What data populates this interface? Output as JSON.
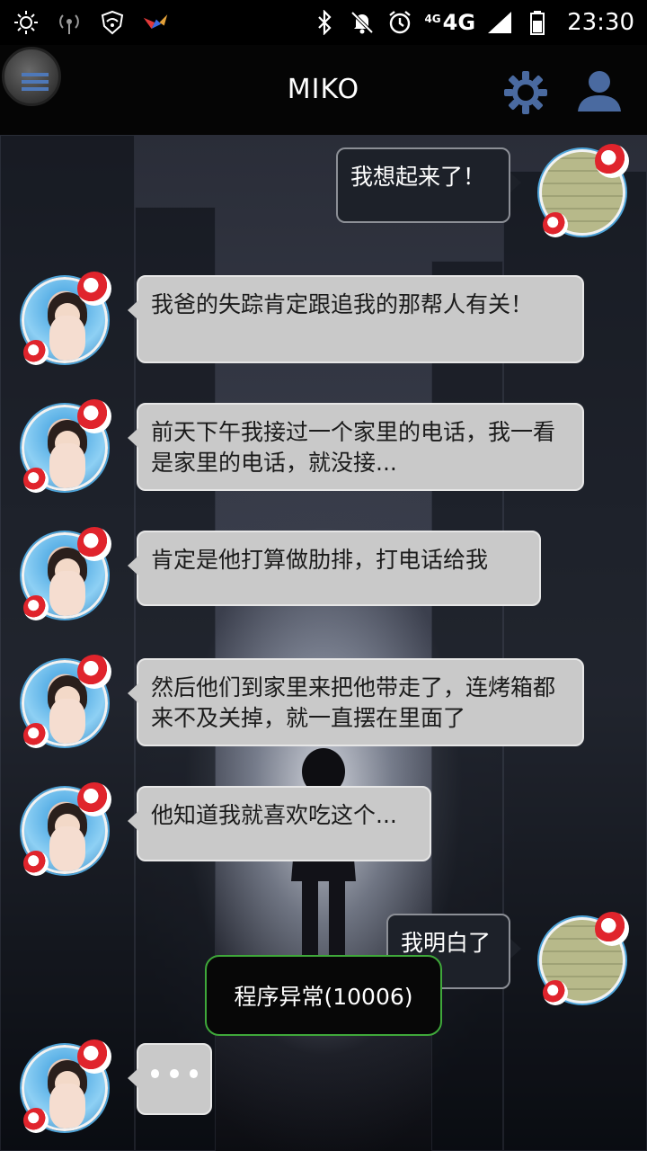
{
  "status_bar": {
    "network": "4G",
    "network_small": "4G",
    "time": "23:30",
    "icons": [
      "brightness-icon",
      "hotspot-icon",
      "vpn-shield-icon",
      "app-notification-icon",
      "bluetooth-icon",
      "mute-icon",
      "alarm-icon",
      "signal-icon",
      "battery-icon"
    ]
  },
  "app_bar": {
    "title": "MIKO",
    "icons": [
      "menu-icon",
      "gear-icon",
      "profile-icon"
    ]
  },
  "messages": [
    {
      "from": "user",
      "text": "我想起来了！"
    },
    {
      "from": "miko",
      "text": "我爸的失踪肯定跟追我的那帮人有关！"
    },
    {
      "from": "miko",
      "text": "前天下午我接过一个家里的电话，我一看是家里的电话，就没接..."
    },
    {
      "from": "miko",
      "text": "肯定是他打算做肋排，打电话给我"
    },
    {
      "from": "miko",
      "text": "然后他们到家里来把他带走了，连烤箱都来不及关掉，就一直摆在里面了"
    },
    {
      "from": "miko",
      "text": "他知道我就喜欢吃这个..."
    },
    {
      "from": "user",
      "text": "我明白了"
    },
    {
      "from": "miko",
      "text": "",
      "typing": true
    }
  ],
  "toast": {
    "text": "程序异常(10006)"
  },
  "colors": {
    "incoming_bubble": "#c9c9c9",
    "outgoing_bubble": "#1d2129",
    "toast_border": "#3fa83a",
    "icon_accent": "#4a6aa0"
  }
}
